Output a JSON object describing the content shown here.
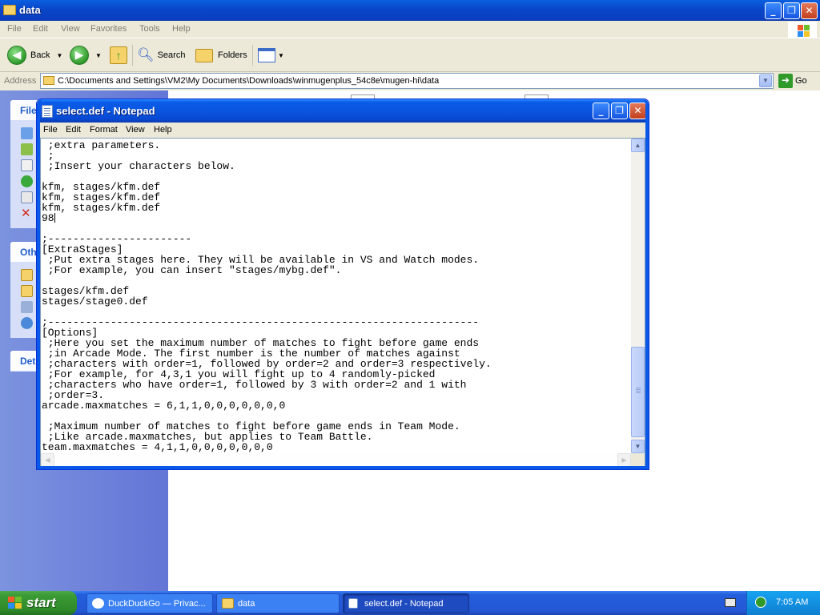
{
  "explorer": {
    "title": "data",
    "menu": [
      "File",
      "Edit",
      "View",
      "Favorites",
      "Tools",
      "Help"
    ],
    "toolbar": {
      "back_label": "Back",
      "search_label": "Search",
      "folders_label": "Folders"
    },
    "address_label": "Address",
    "address_value": "C:\\Documents and Settings\\VM2\\My Documents\\Downloads\\winmugenplus_54c8e\\mugen-hi\\data",
    "go_label": "Go",
    "left_pane": {
      "box1_title": "File",
      "box2_title": "Oth",
      "box3_title": "Det"
    }
  },
  "notepad": {
    "title": "select.def - Notepad",
    "menu": [
      "File",
      "Edit",
      "Format",
      "View",
      "Help"
    ],
    "lines": [
      " ;extra parameters.",
      " ;",
      " ;Insert your characters below.",
      "",
      "kfm, stages/kfm.def",
      "kfm, stages/kfm.def",
      "kfm, stages/kfm.def",
      "98",
      "",
      ";-----------------------",
      "[ExtraStages]",
      " ;Put extra stages here. They will be available in VS and Watch modes.",
      " ;For example, you can insert \"stages/mybg.def\".",
      "",
      "stages/kfm.def",
      "stages/stage0.def",
      "",
      ";---------------------------------------------------------------------",
      "[Options]",
      " ;Here you set the maximum number of matches to fight before game ends",
      " ;in Arcade Mode. The first number is the number of matches against",
      " ;characters with order=1, followed by order=2 and order=3 respectively.",
      " ;For example, for 4,3,1 you will fight up to 4 randomly-picked",
      " ;characters who have order=1, followed by 3 with order=2 and 1 with",
      " ;order=3.",
      "arcade.maxmatches = 6,1,1,0,0,0,0,0,0,0",
      "",
      " ;Maximum number of matches to fight before game ends in Team Mode.",
      " ;Like arcade.maxmatches, but applies to Team Battle.",
      "team.maxmatches = 4,1,1,0,0,0,0,0,0,0"
    ],
    "caret_line": 7
  },
  "taskbar": {
    "start_label": "start",
    "tasks": [
      {
        "label": "DuckDuckGo — Privac...",
        "active": false
      },
      {
        "label": "data",
        "active": false
      },
      {
        "label": "select.def - Notepad",
        "active": true
      }
    ],
    "clock": "7:05 AM"
  },
  "colors": {
    "title_blue": "#0a55e0",
    "taskbar_blue": "#245edb",
    "start_green": "#3a9a34",
    "pane_blue": "#6375d6"
  }
}
